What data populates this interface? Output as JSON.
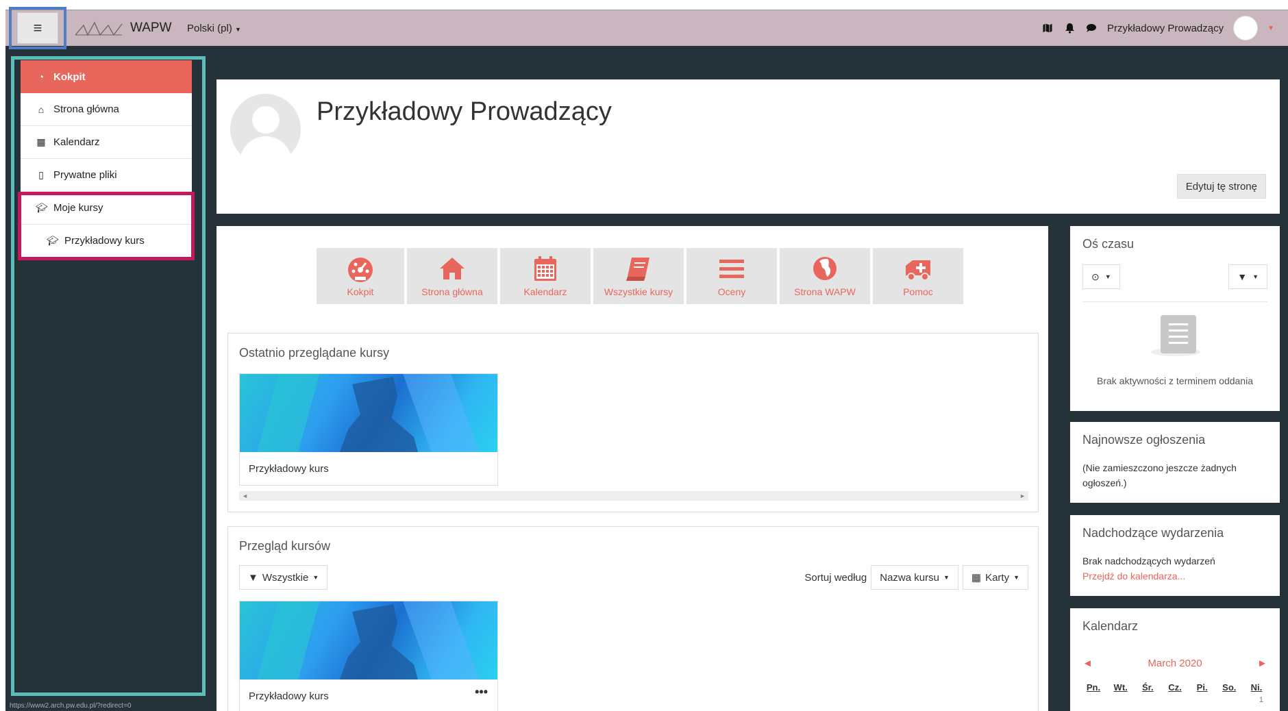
{
  "navbar": {
    "menu_icon": "hamburger-icon",
    "brand": "WAPW",
    "language": "Polski (pl)",
    "icons": [
      "map-icon",
      "bell-icon",
      "chat-icon"
    ],
    "user_name": "Przykładowy Prowadzący"
  },
  "sidebar": {
    "items": [
      {
        "label": "Kokpit",
        "icon": "dashboard-icon"
      },
      {
        "label": "Strona główna",
        "icon": "home-icon"
      },
      {
        "label": "Kalendarz",
        "icon": "calendar-icon"
      },
      {
        "label": "Prywatne pliki",
        "icon": "file-icon"
      },
      {
        "label": "Moje kursy",
        "icon": "graduation-cap-icon"
      },
      {
        "label": "Przykładowy kurs",
        "icon": "graduation-cap-icon"
      }
    ]
  },
  "status_url": "https://www2.arch.pw.edu.pl/?redirect=0",
  "header": {
    "title": "Przykładowy Prowadzący",
    "edit_button": "Edytuj tę stronę"
  },
  "tiles": [
    {
      "label": "Kokpit",
      "icon": "dashboard-icon"
    },
    {
      "label": "Strona główna",
      "icon": "home-icon"
    },
    {
      "label": "Kalendarz",
      "icon": "calendar-icon"
    },
    {
      "label": "Wszystkie kursy",
      "icon": "book-icon"
    },
    {
      "label": "Oceny",
      "icon": "list-icon"
    },
    {
      "label": "Strona WAPW",
      "icon": "globe-icon"
    },
    {
      "label": "Pomoc",
      "icon": "ambulance-icon"
    }
  ],
  "recent": {
    "title": "Ostatnio przeglądane kursy",
    "course_name": "Przykładowy kurs"
  },
  "overview": {
    "title": "Przegląd kursów",
    "filter_label": "Wszystkie",
    "sort_prefix": "Sortuj według",
    "sort_value": "Nazwa kursu",
    "view_value": "Karty",
    "course_name": "Przykładowy kurs",
    "menu_dots": "•••"
  },
  "timeline": {
    "title": "Oś czasu",
    "empty_message": "Brak aktywności z terminem oddania"
  },
  "news": {
    "title": "Najnowsze ogłoszenia",
    "text": "(Nie zamieszczono jeszcze żadnych ogłoszeń.)"
  },
  "upcoming": {
    "title": "Nadchodzące wydarzenia",
    "text": "Brak nadchodzących wydarzeń",
    "link": "Przejdź do kalendarza..."
  },
  "calendar": {
    "title": "Kalendarz",
    "month": "March 2020",
    "prev": "◄",
    "next": "►",
    "days": [
      "Pn.",
      "Wt.",
      "Śr.",
      "Cz.",
      "Pi.",
      "So.",
      "Ni."
    ],
    "first_day": "1"
  },
  "colors": {
    "navbar": "#c9b6bf",
    "dark_bg": "#26323a",
    "accent": "#e8665c",
    "sidebar_outline": "#5bbcb9",
    "mycourses_outline": "#c4195f",
    "menu_outline": "#4f7cc7"
  }
}
